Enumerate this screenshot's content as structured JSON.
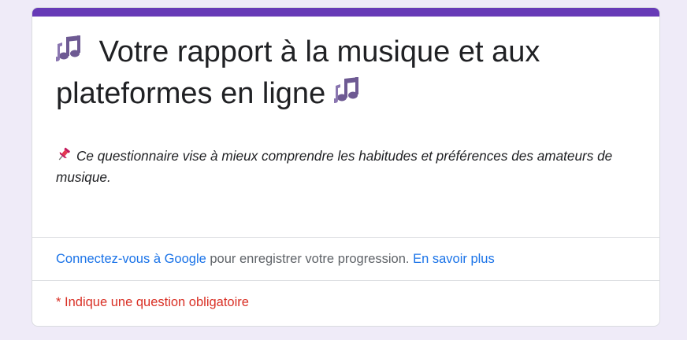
{
  "form": {
    "title_line1": "Votre rapport à la musique et aux",
    "title_line2": "plateformes en ligne",
    "title_emoji_icon": "musical-notes-icon",
    "description": "Ce questionnaire vise à mieux comprendre les habitudes et préférences des amateurs de musique.",
    "description_icon": "pushpin-icon"
  },
  "signin": {
    "link_label": "Connectez-vous à Google",
    "middle_text": " pour enregistrer votre progression. ",
    "learn_more_label": "En savoir plus"
  },
  "required_note": "* Indique une question obligatoire",
  "colors": {
    "accent": "#673ab7",
    "link": "#1a73e8",
    "required": "#d93025",
    "background": "#efebf8"
  }
}
